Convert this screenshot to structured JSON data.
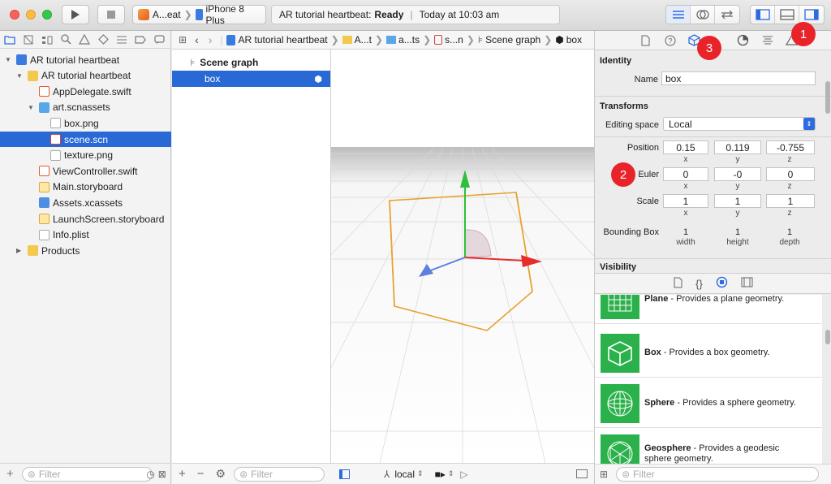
{
  "toolbar": {
    "scheme_target": "A...eat",
    "scheme_device": "iPhone 8 Plus",
    "activity_project": "AR tutorial heartbeat:",
    "activity_status": "Ready",
    "activity_time": "Today at 10:03 am"
  },
  "navigator": {
    "items": [
      {
        "label": "AR tutorial heartbeat",
        "icon": "project-icon"
      },
      {
        "label": "AR tutorial heartbeat",
        "icon": "folder-icon"
      },
      {
        "label": "AppDelegate.swift",
        "icon": "swift-file-icon"
      },
      {
        "label": "art.scnassets",
        "icon": "blue-folder-icon"
      },
      {
        "label": "box.png",
        "icon": "image-file-icon"
      },
      {
        "label": "scene.scn",
        "icon": "scene-file-icon"
      },
      {
        "label": "texture.png",
        "icon": "image-file-icon"
      },
      {
        "label": "ViewController.swift",
        "icon": "swift-file-icon"
      },
      {
        "label": "Main.storyboard",
        "icon": "storyboard-icon"
      },
      {
        "label": "Assets.xcassets",
        "icon": "assets-icon"
      },
      {
        "label": "LaunchScreen.storyboard",
        "icon": "storyboard-icon"
      },
      {
        "label": "Info.plist",
        "icon": "plist-icon"
      },
      {
        "label": "Products",
        "icon": "folder-icon"
      }
    ],
    "filter_placeholder": "Filter"
  },
  "jumpbar": {
    "crumbs": [
      "AR tutorial heartbeat",
      "A...t",
      "a...ts",
      "s...n",
      "Scene graph",
      "box"
    ]
  },
  "scene_graph": {
    "title": "Scene graph",
    "selected_node": "box",
    "filter_placeholder": "Filter"
  },
  "viewport": {
    "space_mode": "local"
  },
  "inspector": {
    "identity": {
      "title": "Identity",
      "name_label": "Name",
      "name_value": "box"
    },
    "transforms": {
      "title": "Transforms",
      "editing_space_label": "Editing space",
      "editing_space_value": "Local",
      "position_label": "Position",
      "position": {
        "x": "0.15",
        "y": "0.119",
        "z": "-0.755"
      },
      "euler_label": "Euler",
      "euler": {
        "x": "0",
        "y": "-0",
        "z": "0"
      },
      "scale_label": "Scale",
      "scale": {
        "x": "1",
        "y": "1",
        "z": "1"
      },
      "bounding_label": "Bounding Box",
      "bounding": {
        "width": "1",
        "height": "1",
        "depth": "1"
      },
      "axis_x": "x",
      "axis_y": "y",
      "axis_z": "z",
      "w_label": "width",
      "h_label": "height",
      "d_label": "depth"
    },
    "visibility": {
      "title": "Visibility"
    }
  },
  "library": {
    "items": [
      {
        "name": "Plane",
        "desc": " - Provides a plane geometry."
      },
      {
        "name": "Box",
        "desc": " - Provides a box geometry."
      },
      {
        "name": "Sphere",
        "desc": " - Provides a sphere geometry."
      },
      {
        "name": "Geosphere",
        "desc": " - Provides a geodesic sphere geometry."
      }
    ],
    "filter_placeholder": "Filter"
  },
  "callouts": {
    "one": "1",
    "two": "2",
    "three": "3"
  },
  "colors": {
    "selection": "#2869d6",
    "callout": "#e8242a",
    "library_thumb": "#2bb14b",
    "box_outline": "#e8a12c"
  }
}
